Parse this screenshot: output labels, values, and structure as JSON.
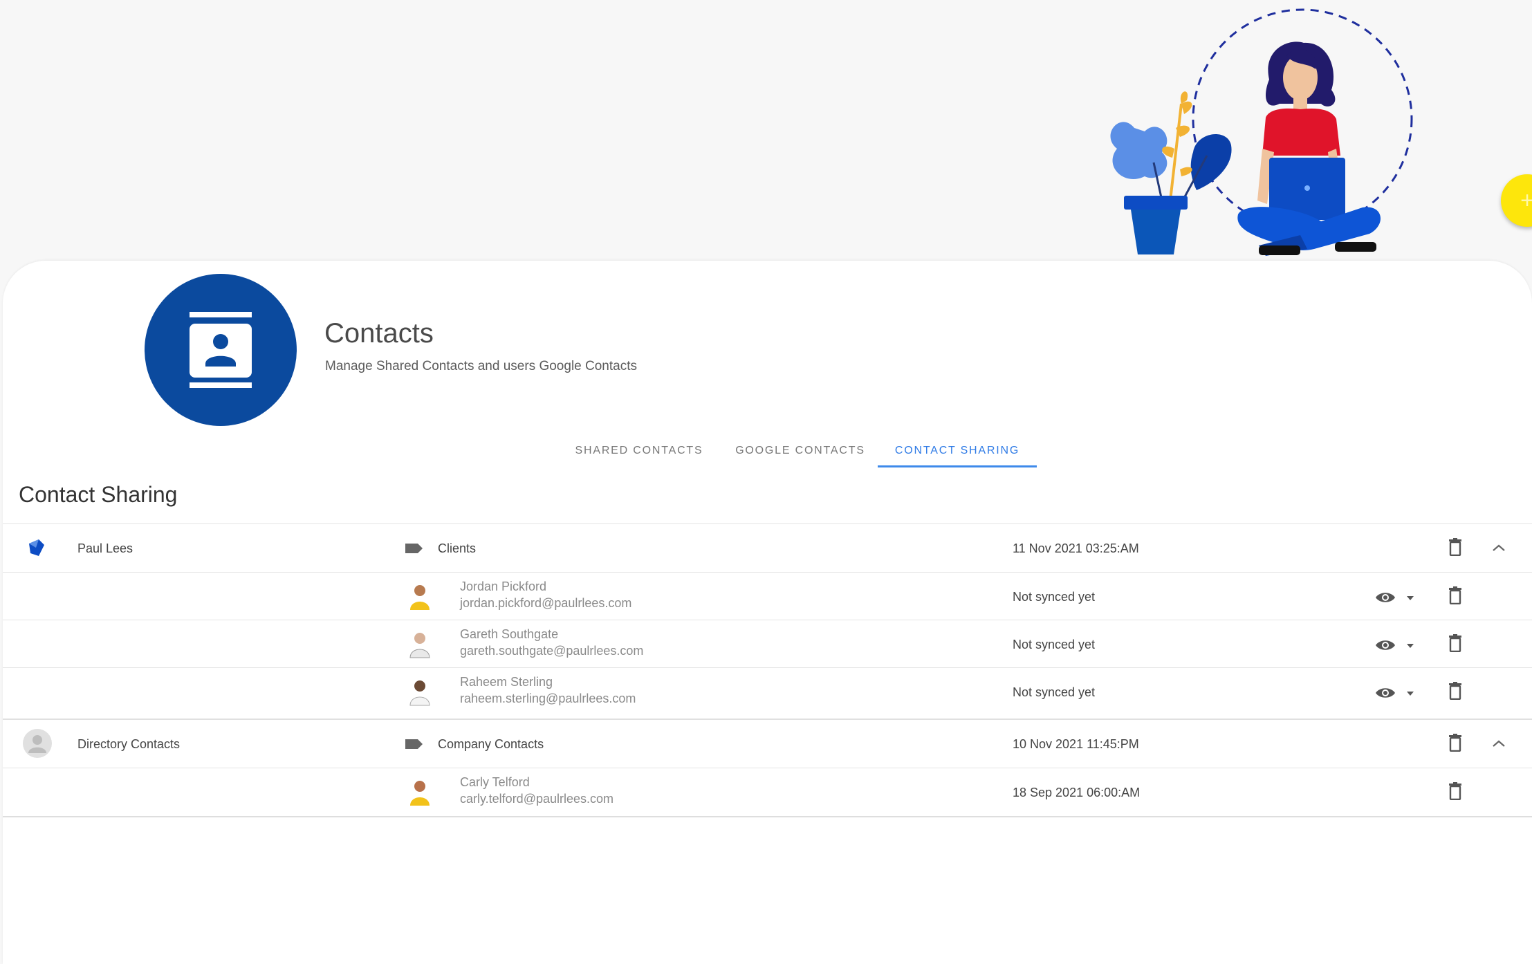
{
  "app": {
    "title": "Contacts",
    "subtitle": "Manage Shared Contacts and users Google Contacts",
    "logo_icon": "contact-card-icon",
    "brand_color": "#0b4a9e"
  },
  "tabs": [
    {
      "label": "SHARED CONTACTS",
      "active": false
    },
    {
      "label": "GOOGLE CONTACTS",
      "active": false
    },
    {
      "label": "CONTACT SHARING",
      "active": true
    }
  ],
  "accent_color": "#2f7be6",
  "fab": {
    "icon": "plus-icon",
    "label": "+",
    "color": "#fde60c"
  },
  "section_title": "Contact Sharing",
  "groups": [
    {
      "owner": "Paul Lees",
      "owner_icon": "user-logo-icon",
      "label": "Clients",
      "date": "11 Nov 2021 03:25:AM",
      "contacts": [
        {
          "name": "Jordan Pickford",
          "email": "jordan.pickford@paulrlees.com",
          "status": "Not synced yet"
        },
        {
          "name": "Gareth Southgate",
          "email": "gareth.southgate@paulrlees.com",
          "status": "Not synced yet"
        },
        {
          "name": "Raheem Sterling",
          "email": "raheem.sterling@paulrlees.com",
          "status": "Not synced yet"
        }
      ]
    },
    {
      "owner": "Directory Contacts",
      "owner_icon": "default-avatar-icon",
      "label": "Company Contacts",
      "date": "10 Nov 2021 11:45:PM",
      "contacts": [
        {
          "name": "Carly Telford",
          "email": "carly.telford@paulrlees.com",
          "status": "18 Sep 2021 06:00:AM"
        }
      ]
    }
  ]
}
